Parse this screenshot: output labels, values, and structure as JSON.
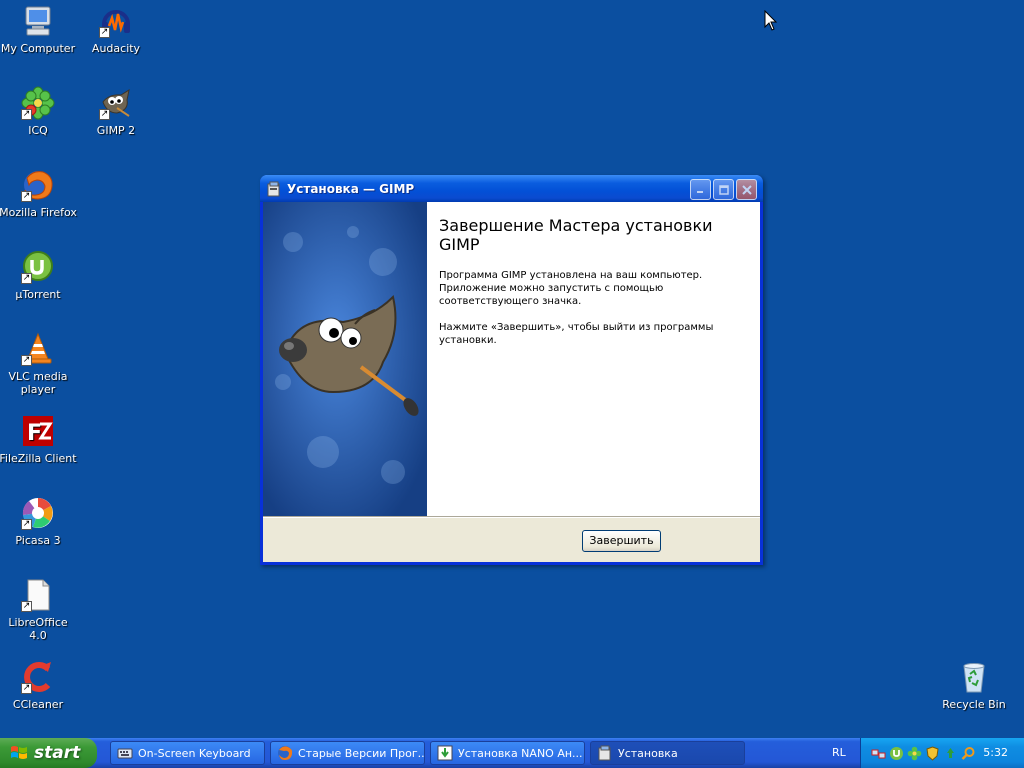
{
  "desktop": {
    "icons": [
      {
        "label": "My Computer"
      },
      {
        "label": "Audacity"
      },
      {
        "label": "ICQ"
      },
      {
        "label": "GIMP 2"
      },
      {
        "label": "Mozilla Firefox"
      },
      {
        "label": "µTorrent"
      },
      {
        "label": "VLC media player"
      },
      {
        "label": "FileZilla Client"
      },
      {
        "label": "Picasa 3"
      },
      {
        "label": "LibreOffice 4.0"
      },
      {
        "label": "CCleaner"
      },
      {
        "label": "Recycle Bin"
      }
    ]
  },
  "window": {
    "title": "Установка — GIMP",
    "heading": "Завершение Мастера установки GIMP",
    "paragraph1": "Программа GIMP установлена на ваш компьютер. Приложение можно запустить с помощью соответствующего значка.",
    "paragraph2": "Нажмите «Завершить», чтобы выйти из программы установки.",
    "finish_label": "Завершить"
  },
  "taskbar": {
    "start_label": "start",
    "tasks": [
      {
        "label": "On-Screen Keyboard"
      },
      {
        "label": "Старые Версии Прог..."
      },
      {
        "label": "Установка NANO Ан..."
      },
      {
        "label": "Установка"
      }
    ],
    "language": "RL",
    "clock": "5:32"
  },
  "colors": {
    "desktop": "#0b4fa0",
    "titlebar": "#0a5ddf",
    "start": "#3c9a37",
    "tray": "#0f8de2"
  }
}
